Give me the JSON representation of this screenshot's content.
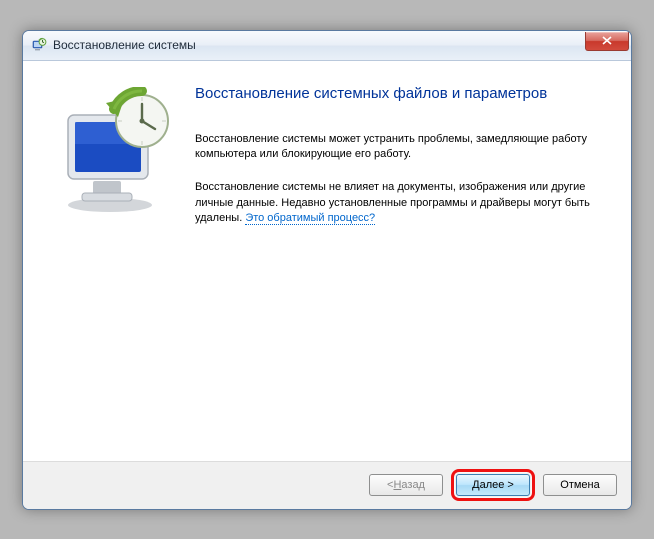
{
  "window": {
    "title": "Восстановление системы"
  },
  "content": {
    "heading": "Восстановление системных файлов и параметров",
    "paragraph1": "Восстановление системы может устранить проблемы, замедляющие работу компьютера или блокирующие его работу.",
    "paragraph2_before_link": "Восстановление системы не влияет на документы, изображения или другие личные данные. Недавно установленные программы и драйверы могут быть удалены. ",
    "help_link": "Это обратимый процесс?"
  },
  "footer": {
    "back_prefix": "< ",
    "back_u": "Н",
    "back_rest": "азад",
    "next_u": "Д",
    "next_rest": "алее >",
    "cancel": "Отмена"
  }
}
